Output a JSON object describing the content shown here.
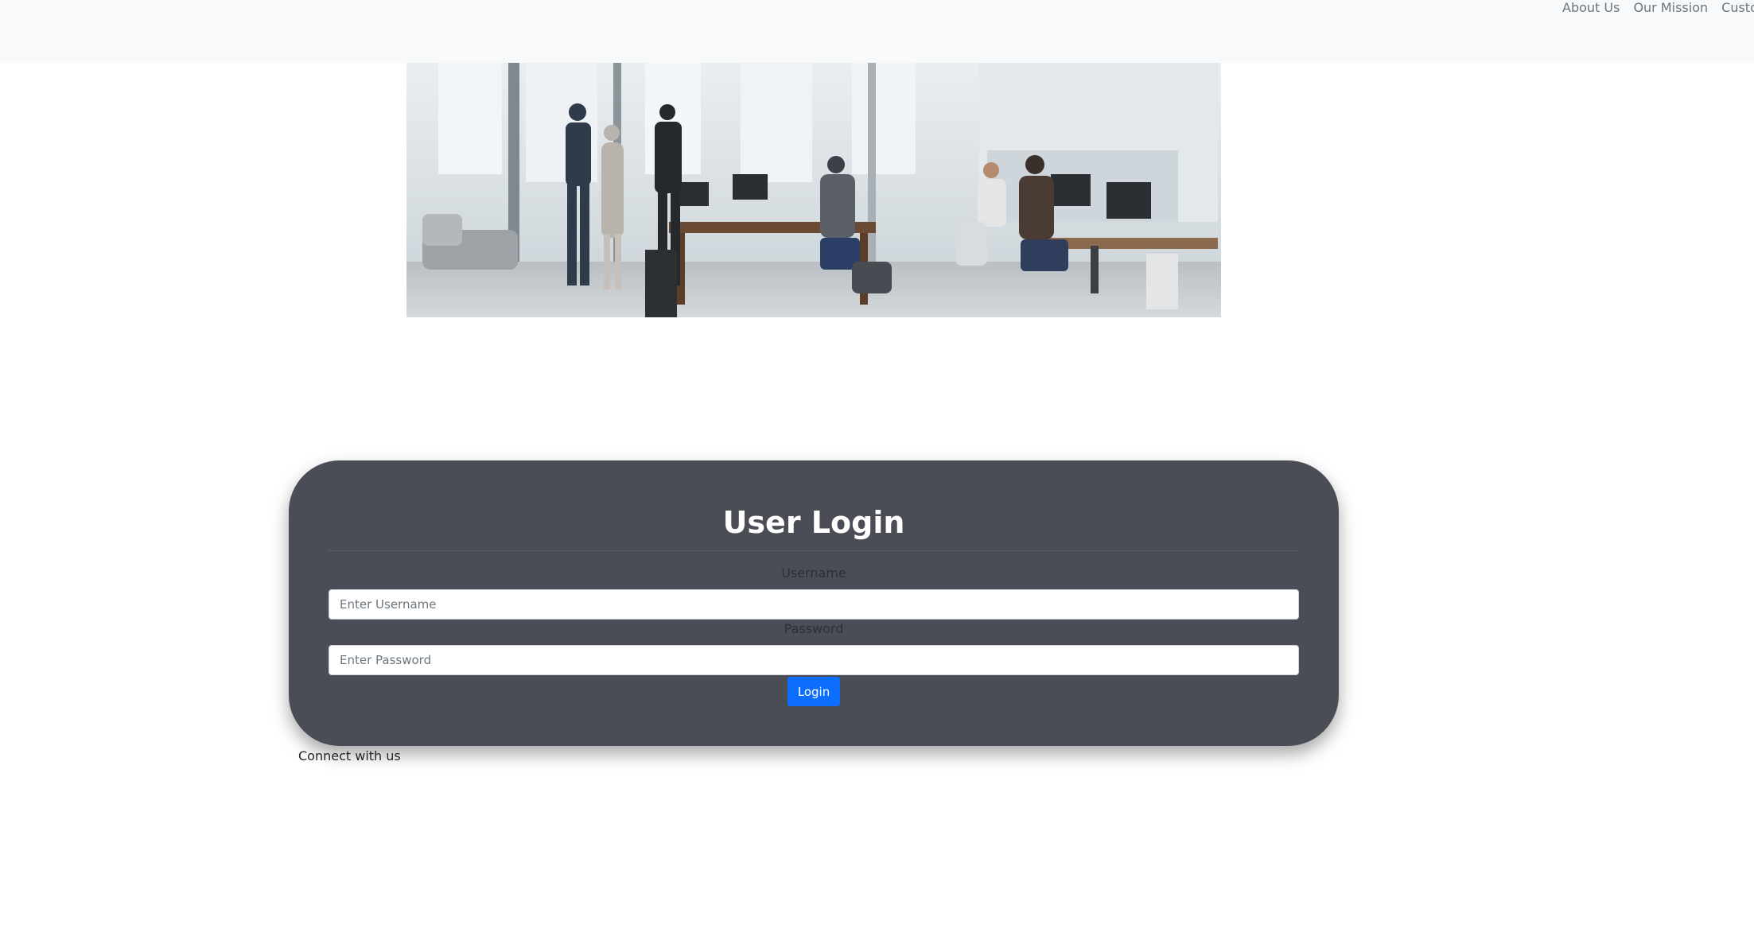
{
  "nav": {
    "links": [
      "About Us",
      "Our Mission",
      "Customer"
    ]
  },
  "hero": {
    "alt": "office team photo"
  },
  "login": {
    "title": "User Login",
    "username_label": "Username",
    "username_placeholder": "Enter Username",
    "password_label": "Password",
    "password_placeholder": "Enter Password",
    "button_label": "Login"
  },
  "footer": {
    "connect_text": "Connect with us"
  },
  "colors": {
    "navbar_bg": "#f8f9fa",
    "card_bg": "#4b4d56",
    "button_bg": "#0d6efd"
  }
}
